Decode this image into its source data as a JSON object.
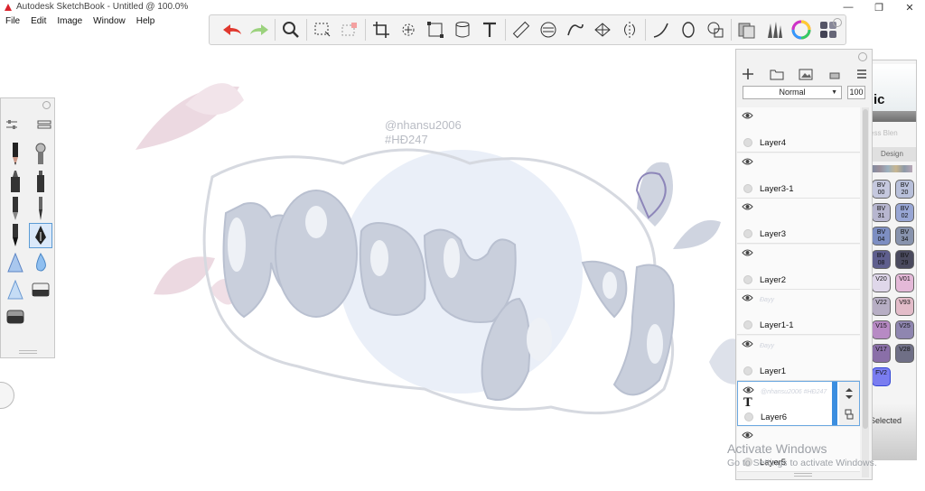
{
  "window": {
    "title": "Autodesk SketchBook - Untitled @ 100.0%",
    "minimize": "—",
    "maximize": "❐",
    "close": "✕"
  },
  "menu": [
    "File",
    "Edit",
    "Image",
    "Window",
    "Help"
  ],
  "canvas": {
    "watermark_line1": "@nhansu2006",
    "watermark_line2": "#HĐ247"
  },
  "toolbar": {
    "tools": [
      "undo-icon",
      "redo-icon",
      "zoom-icon",
      "rect-select-icon",
      "lasso-select-icon",
      "crop-icon",
      "move-rotate-icon",
      "distort-icon",
      "fill-icon",
      "text-icon",
      "ruler-icon",
      "ellipse-guide-icon",
      "french-curve-icon",
      "perspective-icon",
      "symmetry-icon",
      "stroke-icon",
      "ellipse-icon",
      "shape-icon",
      "copic-library-icon",
      "brush-library-icon",
      "color-wheel-icon",
      "palette-icon"
    ]
  },
  "layers_panel": {
    "blend_mode": "Normal",
    "opacity": "100",
    "layers": [
      {
        "name": "Layer4",
        "thumb": ""
      },
      {
        "name": "Layer3-1",
        "thumb": ""
      },
      {
        "name": "Layer3",
        "thumb": ""
      },
      {
        "name": "Layer2",
        "thumb": ""
      },
      {
        "name": "Layer1-1",
        "thumb": "Đayy"
      },
      {
        "name": "Layer1",
        "thumb": "Đayy"
      },
      {
        "name": "Layer6",
        "thumb": "@nhansu2006 #HĐ247"
      },
      {
        "name": "Layer5",
        "thumb": ""
      }
    ]
  },
  "copic": {
    "logo": "ic",
    "subtitle": "ess Blen",
    "tab": "Design",
    "selected_label": "Selected",
    "swatches": [
      {
        "code": "BV 00",
        "color": "#c5c8de"
      },
      {
        "code": "BV 20",
        "color": "#b8c0da"
      },
      {
        "code": "BV 31",
        "color": "#b7b6cf"
      },
      {
        "code": "BV 02",
        "color": "#98a6d4"
      },
      {
        "code": "BV 04",
        "color": "#7d8ec2"
      },
      {
        "code": "BV 34",
        "color": "#8893ad"
      },
      {
        "code": "BV 08",
        "color": "#5f5f8e"
      },
      {
        "code": "BV 29",
        "color": "#4a4a5e"
      },
      {
        "code": "V20",
        "color": "#dfd7ea"
      },
      {
        "code": "V01",
        "color": "#e4b9d8"
      },
      {
        "code": "V22",
        "color": "#b7aec4"
      },
      {
        "code": "V93",
        "color": "#e3bcc9"
      },
      {
        "code": "V15",
        "color": "#b78ac4"
      },
      {
        "code": "V25",
        "color": "#8f86b0"
      },
      {
        "code": "V17",
        "color": "#8a6fa8"
      },
      {
        "code": "V28",
        "color": "#6f6f86"
      },
      {
        "code": "FV2",
        "color": "#7a7df0"
      }
    ]
  },
  "os": {
    "activate_title": "Activate Windows",
    "activate_sub": "Go to Settings to activate Windows."
  }
}
